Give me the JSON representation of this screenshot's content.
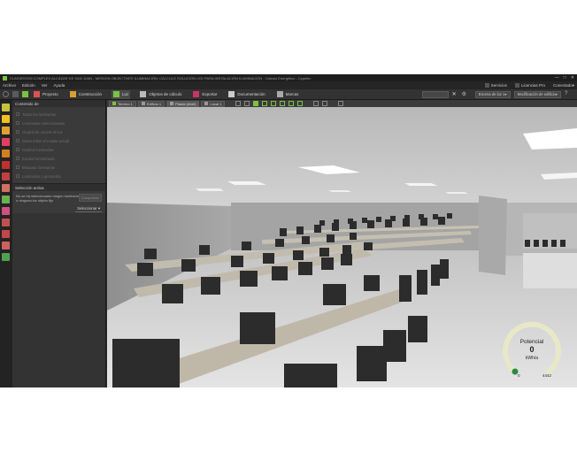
{
  "window": {
    "title": "CLASSROOM COMPLEX ALCÁZAR DE SAN JUAN - MISSION OBJECTIVES ILUMINACIÓN: CÁLCULO SOLUCIÓN LED PARA INSTALACIÓN ILUMINACIÓN - Cálculo Energético - Cypelec",
    "controls": [
      "—",
      "□",
      "✕"
    ]
  },
  "menu": {
    "items": [
      "Archivo",
      "Edición",
      "Ver",
      "Ayuda"
    ],
    "right_items": [
      "Servicios",
      "Licencias Pro",
      "Conectado"
    ]
  },
  "toolbar": {
    "buttons": [
      {
        "label": "Proyecto",
        "icon": "project-icon",
        "color": "#e05050"
      },
      {
        "label": "Construcción",
        "icon": "construction-icon",
        "color": "#d9a030"
      },
      {
        "label": "Luz",
        "icon": "light-icon",
        "color": "#7cc242"
      },
      {
        "label": "Objetos de cálculo",
        "icon": "objects-icon",
        "color": "#bbbbbb"
      },
      {
        "label": "Exportar",
        "icon": "export-icon",
        "color": "#cc3366"
      },
      {
        "label": "Documentación",
        "icon": "documentation-icon",
        "color": "#cccccc"
      },
      {
        "label": "Marcas",
        "icon": "marks-icon",
        "color": "#aaaaaa"
      }
    ],
    "escena_label": "Escena de luz 1",
    "modification_label": "Modificación de edificio"
  },
  "sidebar": {
    "icons": [
      {
        "name": "light-scene-icon",
        "color": "#c8c040"
      },
      {
        "name": "bulb-icon",
        "color": "#f0c020"
      },
      {
        "name": "luminaire-icon",
        "color": "#e0a030"
      },
      {
        "name": "color-wheel-icon",
        "color": "#e04060"
      },
      {
        "name": "sun-icon",
        "color": "#d08020"
      },
      {
        "name": "window-icon",
        "color": "#c03030"
      },
      {
        "name": "door-icon",
        "color": "#c04040"
      },
      {
        "name": "wrench-icon",
        "color": "#d07060"
      },
      {
        "name": "leaf-icon",
        "color": "#6ab04c"
      },
      {
        "name": "report-icon",
        "color": "#d05080"
      },
      {
        "name": "table-icon",
        "color": "#c05050"
      },
      {
        "name": "chart-icon",
        "color": "#c04848"
      },
      {
        "name": "screen-icon",
        "color": "#d06060"
      },
      {
        "name": "settings-icon",
        "color": "#50a050"
      }
    ]
  },
  "panel": {
    "header": "Contenido de",
    "items": [
      "Todas las luminarias",
      "Luminarias seleccionadas",
      "Grupos de control de luz",
      "Datos sobre el estado actual",
      "Sustituir luminarias",
      "Escalar la luminaria",
      "Bloquear luminarias",
      "Luminarias y geometría"
    ],
    "section_title": "Selección activa",
    "note": "No se ha seleccionado ningún luminario o ninguna luz objeto fijo",
    "note_button": "Comprobar",
    "select_label": "Seleccionar"
  },
  "viewport": {
    "tabs": [
      "Terreno 1",
      "Edificio 1",
      "Planta (nivel)",
      "Local 1"
    ]
  },
  "gauge": {
    "title": "Potencial",
    "value": "0",
    "unit": "kWh/a",
    "min": "0",
    "max": "4442",
    "fraction": 0.0,
    "ring_color": "#e8e8c8",
    "dot_color": "#2e8b3a"
  }
}
